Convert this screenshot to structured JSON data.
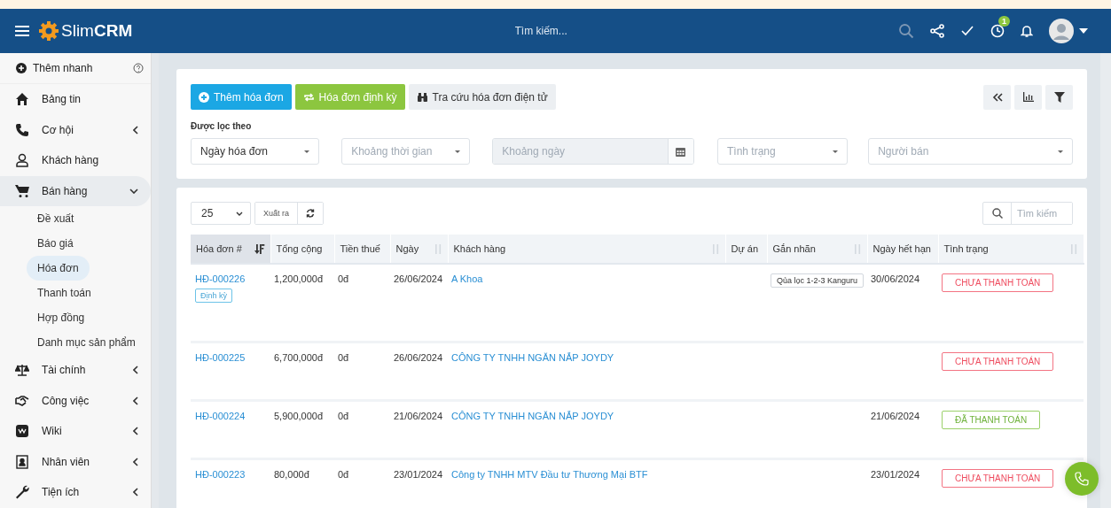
{
  "header": {
    "logo": "Slim**CRM**",
    "search_placeholder": "Tìm kiếm...",
    "notification_count": "1"
  },
  "sidebar": {
    "quick_add": "Thêm nhanh",
    "items": [
      {
        "label": "Bảng tin",
        "kind": "link",
        "selected": false
      },
      {
        "label": "Cơ hội",
        "kind": "group",
        "selected": false,
        "expanded": false
      },
      {
        "label": "Khách hàng",
        "kind": "link",
        "selected": false
      },
      {
        "label": "Bán hàng",
        "kind": "group",
        "selected": true,
        "expanded": true,
        "children": [
          {
            "label": "Đề xuất",
            "selected": false
          },
          {
            "label": "Báo giá",
            "selected": false
          },
          {
            "label": "Hóa đơn",
            "selected": true
          },
          {
            "label": "Thanh toán",
            "selected": false
          },
          {
            "label": "Hợp đồng",
            "selected": false
          },
          {
            "label": "Danh mục sản phẩm",
            "selected": false
          }
        ]
      },
      {
        "label": "Tài chính",
        "kind": "group",
        "selected": false,
        "expanded": false
      },
      {
        "label": "Công việc",
        "kind": "group",
        "selected": false,
        "expanded": false
      },
      {
        "label": "Wiki",
        "kind": "group",
        "selected": false,
        "expanded": false
      },
      {
        "label": "Nhân viên",
        "kind": "group",
        "selected": false,
        "expanded": false
      },
      {
        "label": "Tiện ích",
        "kind": "group",
        "selected": false,
        "expanded": false
      }
    ]
  },
  "filter_panel": {
    "buttons": [
      {
        "label": "Thêm hóa đơn",
        "kind": "primary"
      },
      {
        "label": "Hóa đơn định kỳ",
        "kind": "success"
      },
      {
        "label": "Tra cứu hóa đơn điện tử",
        "kind": "default"
      }
    ],
    "filter_label": "Được lọc theo",
    "filters": [
      {
        "kind": "select",
        "value": "Ngày hóa đơn"
      },
      {
        "kind": "select",
        "placeholder": "Khoảng thời gian"
      },
      {
        "kind": "date",
        "placeholder": "Khoảng ngày",
        "disabled": true
      },
      {
        "kind": "select",
        "placeholder": "Tình trạng"
      },
      {
        "kind": "select",
        "placeholder": "Người bán"
      }
    ]
  },
  "table_panel": {
    "page_size": "25",
    "export_label": "Xuất ra",
    "search_placeholder": "Tìm kiếm",
    "columns": [
      {
        "label": "Hóa đơn #",
        "sortable": true,
        "sorted": true
      },
      {
        "label": "Tổng cộng",
        "sortable": false,
        "sorted": false
      },
      {
        "label": "Tiền thuế",
        "sortable": false,
        "sorted": false
      },
      {
        "label": "Ngày",
        "sortable": true,
        "sorted": false
      },
      {
        "label": "Khách hàng",
        "sortable": true,
        "sorted": false
      },
      {
        "label": "Dự án",
        "sortable": false,
        "sorted": false
      },
      {
        "label": "Gắn nhãn",
        "sortable": true,
        "sorted": false
      },
      {
        "label": "Ngày hết hạn",
        "sortable": false,
        "sorted": false
      },
      {
        "label": "Tình trạng",
        "sortable": true,
        "sorted": false
      }
    ],
    "rows": [
      {
        "invoice": "HĐ-000226",
        "recurring_tag": "Định kỳ",
        "total": "1,200,000đ",
        "tax": "0đ",
        "date": "26/06/2024",
        "customer": "A Khoa",
        "tag": "Qủa lọc 1-2-3 Kanguru",
        "due_date": "30/06/2024",
        "status": {
          "label": "CHƯA THANH TOÁN",
          "kind": "unpaid"
        }
      },
      {
        "invoice": "HĐ-000225",
        "total": "6,700,000đ",
        "tax": "0đ",
        "date": "26/06/2024",
        "customer": "CÔNG TY TNHH NGĂN NẮP JOYDY",
        "status": {
          "label": "CHƯA THANH TOÁN",
          "kind": "unpaid"
        }
      },
      {
        "invoice": "HĐ-000224",
        "total": "5,900,000đ",
        "tax": "0đ",
        "date": "21/06/2024",
        "customer": "CÔNG TY TNHH NGĂN NẮP JOYDY",
        "due_date": "21/06/2024",
        "status": {
          "label": "ĐÃ THANH TOÁN",
          "kind": "paid"
        }
      },
      {
        "invoice": "HĐ-000223",
        "total": "80,000đ",
        "tax": "0đ",
        "date": "23/01/2024",
        "customer": "Công ty TNHH MTV Đầu tư Thương Mại BTF",
        "due_date": "23/01/2024",
        "status": {
          "label": "CHƯA THANH TOÁN",
          "kind": "unpaid"
        }
      }
    ]
  }
}
